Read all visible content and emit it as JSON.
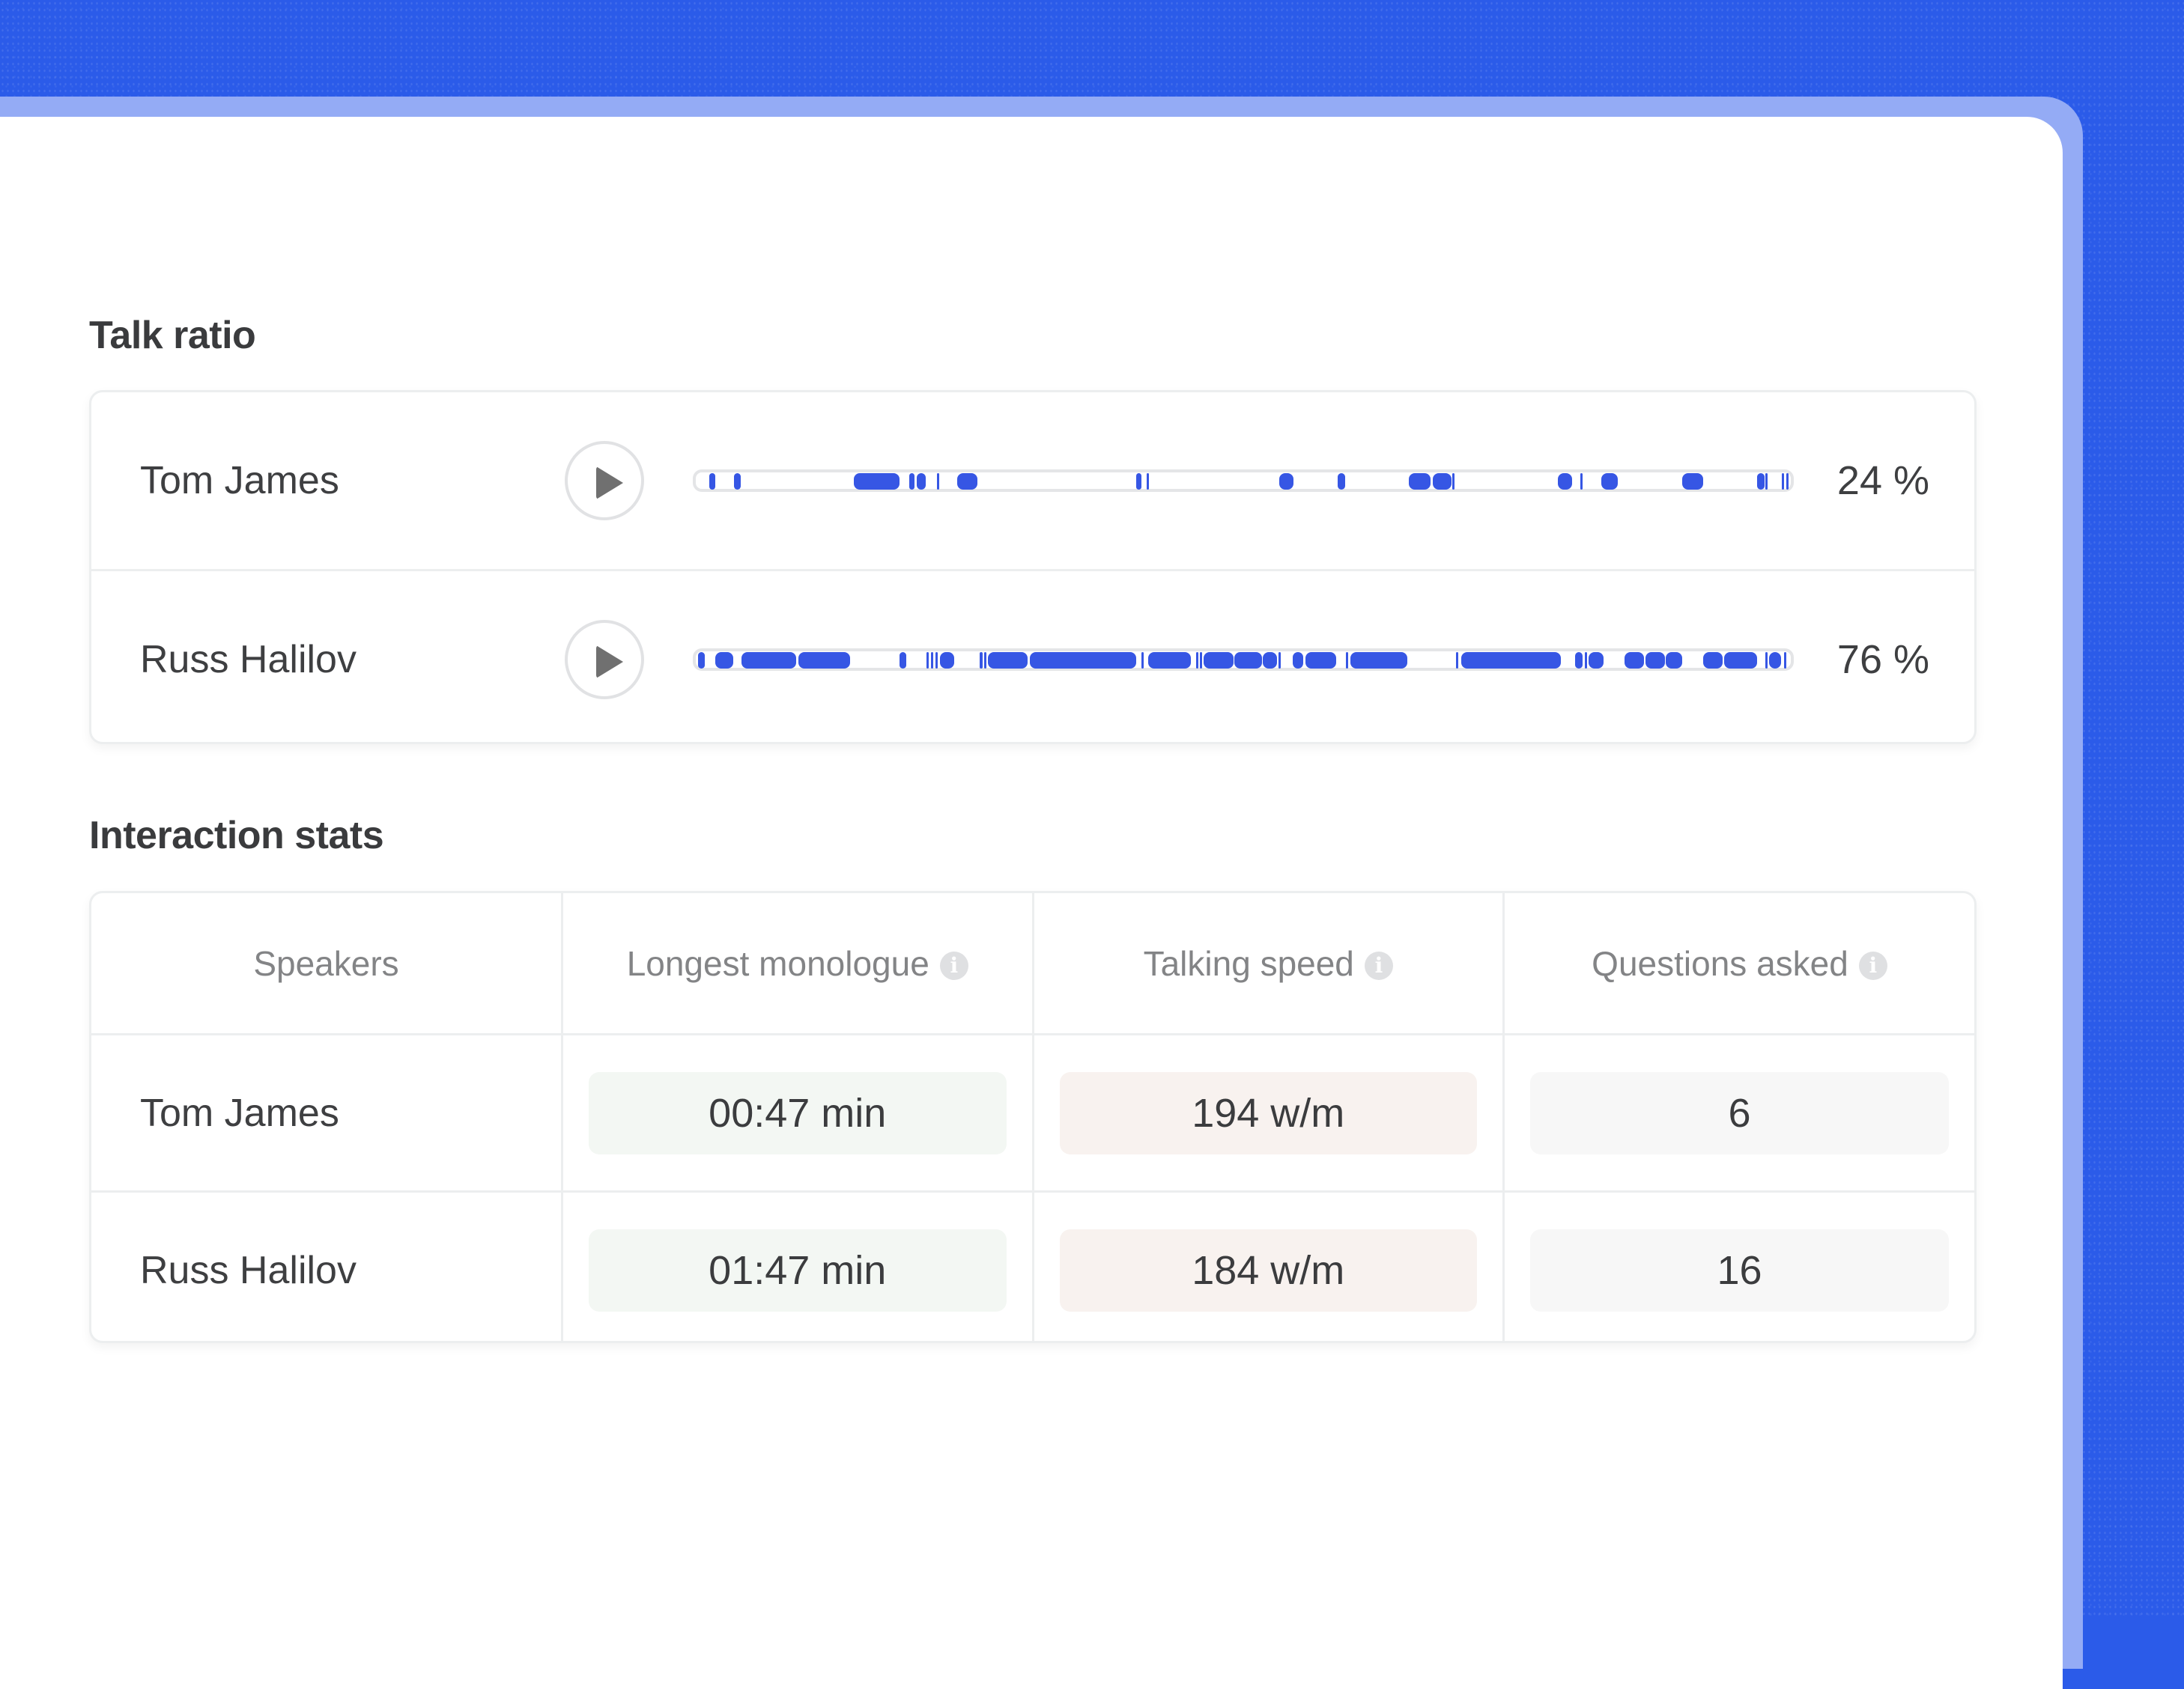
{
  "colors": {
    "background": "#2b5be9",
    "accent": "#3656e4",
    "monologue_bg": "#f3f7f3",
    "speed_bg": "#f8f2ef",
    "questions_bg": "#f7f7f7"
  },
  "talk_ratio": {
    "title": "Talk ratio",
    "speakers": [
      {
        "name": "Tom James",
        "percent": "24 %",
        "play_icon": "play-icon",
        "segments": [
          [
            0.012,
            0.018
          ],
          [
            0.035,
            0.041
          ],
          [
            0.144,
            0.186
          ],
          [
            0.195,
            0.2
          ],
          [
            0.202,
            0.21
          ],
          [
            0.22,
            0.221
          ],
          [
            0.239,
            0.257
          ],
          [
            0.402,
            0.407
          ],
          [
            0.412,
            0.413
          ],
          [
            0.533,
            0.546
          ],
          [
            0.586,
            0.593
          ],
          [
            0.651,
            0.671
          ],
          [
            0.673,
            0.69
          ],
          [
            0.691,
            0.692
          ],
          [
            0.787,
            0.8
          ],
          [
            0.808,
            0.81
          ],
          [
            0.827,
            0.842
          ],
          [
            0.901,
            0.92
          ],
          [
            0.969,
            0.976
          ],
          [
            0.977,
            0.979
          ],
          [
            0.992,
            0.993
          ],
          [
            0.996,
            0.997
          ]
        ]
      },
      {
        "name": "Russ Halilov",
        "percent": "76 %",
        "play_icon": "play-icon",
        "segments": [
          [
            0.002,
            0.008
          ],
          [
            0.018,
            0.034
          ],
          [
            0.042,
            0.092
          ],
          [
            0.094,
            0.141
          ],
          [
            0.186,
            0.192
          ],
          [
            0.211,
            0.213
          ],
          [
            0.215,
            0.217
          ],
          [
            0.219,
            0.221
          ],
          [
            0.223,
            0.236
          ],
          [
            0.259,
            0.262
          ],
          [
            0.263,
            0.265
          ],
          [
            0.267,
            0.303
          ],
          [
            0.305,
            0.402
          ],
          [
            0.407,
            0.409
          ],
          [
            0.413,
            0.452
          ],
          [
            0.457,
            0.458
          ],
          [
            0.46,
            0.462
          ],
          [
            0.464,
            0.491
          ],
          [
            0.492,
            0.517
          ],
          [
            0.518,
            0.531
          ],
          [
            0.532,
            0.534
          ],
          [
            0.545,
            0.555
          ],
          [
            0.557,
            0.585
          ],
          [
            0.594,
            0.596
          ],
          [
            0.598,
            0.65
          ],
          [
            0.694,
            0.696
          ],
          [
            0.699,
            0.79
          ],
          [
            0.803,
            0.81
          ],
          [
            0.812,
            0.813
          ],
          [
            0.815,
            0.829
          ],
          [
            0.848,
            0.866
          ],
          [
            0.867,
            0.885
          ],
          [
            0.886,
            0.901
          ],
          [
            0.92,
            0.938
          ],
          [
            0.939,
            0.969
          ],
          [
            0.977,
            0.978
          ],
          [
            0.98,
            0.991
          ],
          [
            0.994,
            0.996
          ]
        ]
      }
    ]
  },
  "interaction_stats": {
    "title": "Interaction stats",
    "columns": [
      {
        "label": "Speakers",
        "info": false
      },
      {
        "label": "Longest monologue",
        "info": true
      },
      {
        "label": "Talking speed",
        "info": true
      },
      {
        "label": "Questions asked",
        "info": true
      }
    ],
    "info_glyph": "i",
    "rows": [
      {
        "speaker": "Tom James",
        "longest_monologue": "00:47 min",
        "talking_speed": "194 w/m",
        "questions_asked": "6"
      },
      {
        "speaker": "Russ Halilov",
        "longest_monologue": "01:47 min",
        "talking_speed": "184 w/m",
        "questions_asked": "16"
      }
    ]
  }
}
